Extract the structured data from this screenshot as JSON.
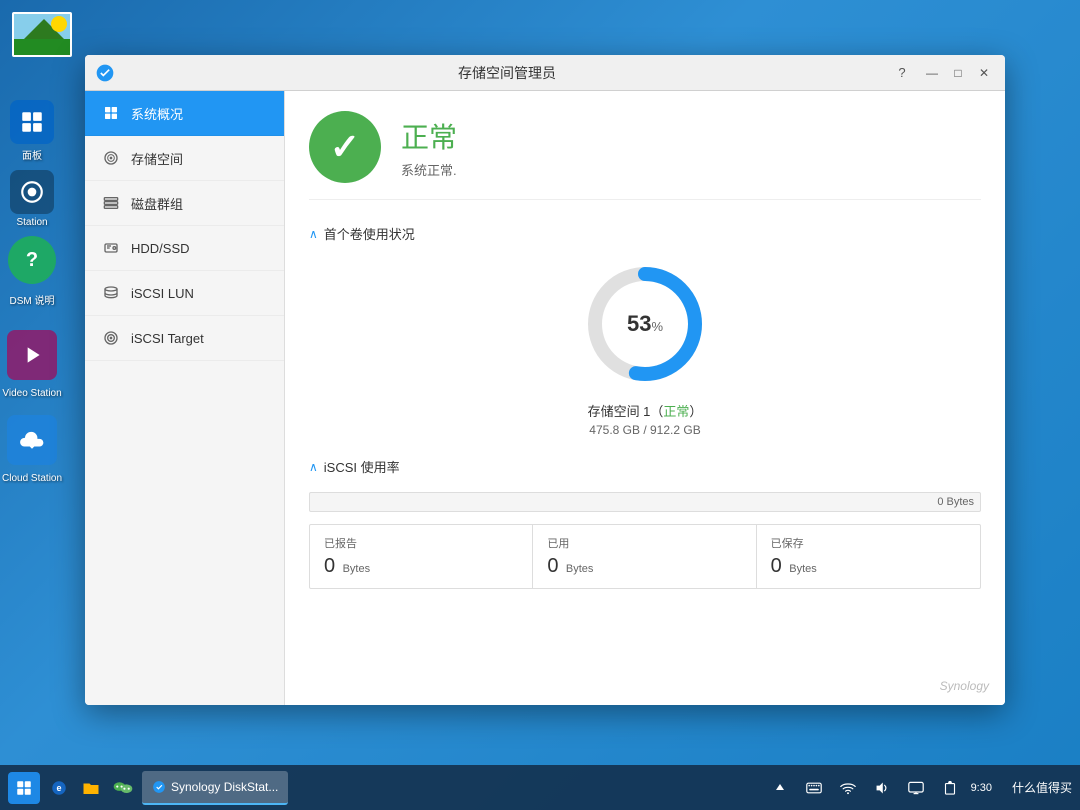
{
  "desktop": {
    "background_color": "#2a7fbf"
  },
  "window": {
    "title": "存储空间管理员",
    "help_btn": "?",
    "minimize_btn": "—",
    "maximize_btn": "□",
    "close_btn": "✕"
  },
  "sidebar": {
    "items": [
      {
        "id": "overview",
        "label": "系统概况",
        "active": true
      },
      {
        "id": "storage",
        "label": "存储空间"
      },
      {
        "id": "diskgroup",
        "label": "磁盘群组"
      },
      {
        "id": "hddssd",
        "label": "HDD/SSD"
      },
      {
        "id": "iscsi-lun",
        "label": "iSCSI LUN"
      },
      {
        "id": "iscsi-target",
        "label": "iSCSI Target"
      }
    ]
  },
  "status": {
    "label": "正常",
    "sub_label": "系统正常."
  },
  "volume_section": {
    "header_arrow": "∧",
    "header_text": "首个卷使用状况",
    "percent": "53",
    "percent_sign": "%",
    "volume_name": "存储空间 1（正常）",
    "volume_size": "475.8 GB / 912.2 GB",
    "donut_total": 283,
    "donut_used_dash": 150,
    "donut_gap": 133
  },
  "iscsi_section": {
    "header_arrow": "∧",
    "header_text": "iSCSI 使用率",
    "bytes_label": "0 Bytes",
    "stats": [
      {
        "label": "已报告",
        "value": "0",
        "unit": "Bytes"
      },
      {
        "label": "已用",
        "value": "0",
        "unit": "Bytes"
      },
      {
        "label": "已保存",
        "value": "0",
        "unit": "Bytes"
      }
    ]
  },
  "watermark": "Synology",
  "taskbar": {
    "items": [
      {
        "label": "Synology DiskStat..."
      }
    ],
    "right_icons": [
      "△",
      "🔲",
      "📶",
      "🔊",
      "🖥",
      "📋",
      "🕐"
    ]
  },
  "left_icons": [
    {
      "label": "面板"
    },
    {
      "label": "Station"
    },
    {
      "label": "DSM 说明"
    }
  ]
}
